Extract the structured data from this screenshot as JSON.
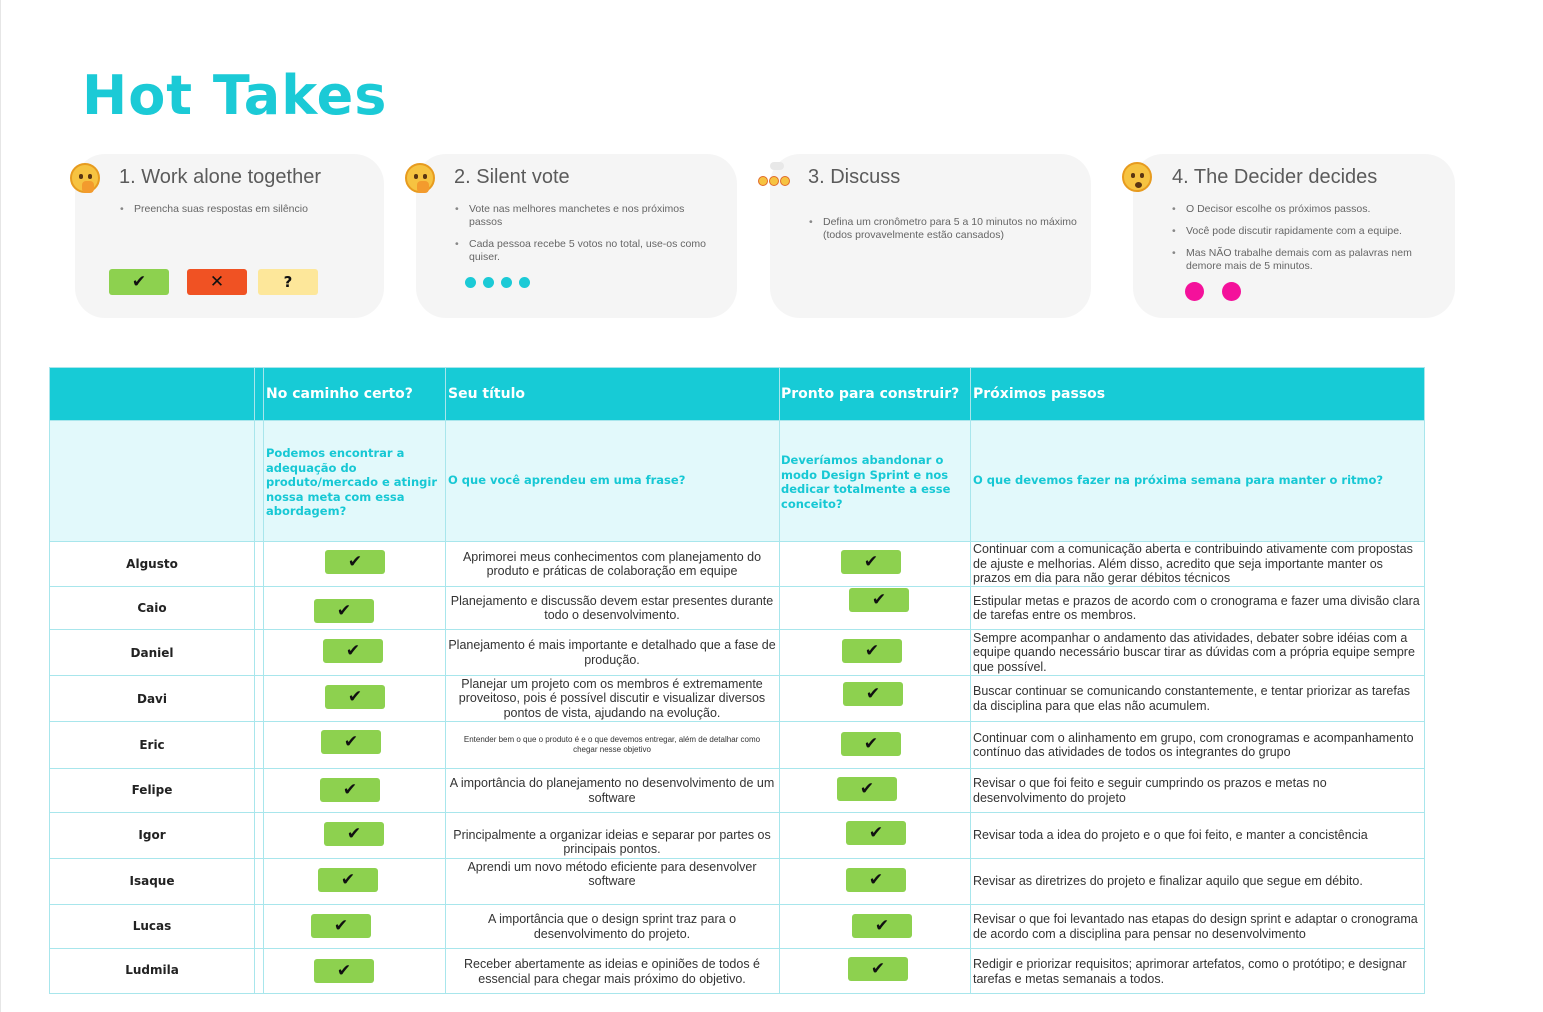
{
  "title": "Hot Takes",
  "steps": [
    {
      "heading": "1. Work alone together",
      "bullets": [
        "Preencha suas respostas em silêncio"
      ]
    },
    {
      "heading": "2. Silent vote",
      "bullets": [
        "Vote nas melhores manchetes e nos próximos passos",
        "Cada pessoa recebe 5 votos no total, use-os como quiser."
      ]
    },
    {
      "heading": "3. Discuss",
      "bullets": [
        "Defina um cronômetro para 5 a 10 minutos no máximo\n(todos provavelmente estão cansados)"
      ]
    },
    {
      "heading": "4. The Decider decides",
      "bullets": [
        "O Decisor escolhe os próximos passos.",
        "Você pode discutir rapidamente com a equipe.",
        "Mas NÃO trabalhe demais com as palavras nem demore mais de 5 minutos."
      ]
    }
  ],
  "vote_buttons": {
    "yes": "✔",
    "no": "✕",
    "maybe": "?"
  },
  "colors": {
    "accent": "#1bcad6",
    "green": "#8dd14f",
    "red": "#f05223",
    "yellow": "#fde79a",
    "magenta": "#f4119b"
  },
  "table": {
    "headers": [
      "No caminho certo?",
      "Seu título",
      "Pronto para construir?",
      "Próximos passos"
    ],
    "prompts": [
      "Podemos encontrar a adequação do produto/mercado e atingir nossa meta com essa abordagem?",
      "O que você aprendeu em uma frase?",
      "Deveríamos abandonar o modo Design Sprint e nos dedicar totalmente a esse conceito?",
      "O que devemos fazer na próxima semana para manter o ritmo?"
    ],
    "check_symbol": "✔",
    "rows": [
      {
        "name": "Algusto",
        "on_track": "✔",
        "title": "Aprimorei meus conhecimentos com planejamento do produto e práticas de colaboração em equipe",
        "ready": "✔",
        "next": "Continuar com a comunicação aberta e contribuindo ativamente com propostas de ajuste e melhorias. Além disso, acredito que seja importante manter os prazos em dia para não gerar débitos técnicos"
      },
      {
        "name": "Caio",
        "on_track": "✔",
        "title": "Planejamento e discussão devem estar presentes durante todo o desenvolvimento.",
        "ready": "✔",
        "next": "Estipular metas e prazos de acordo com o cronograma e fazer uma divisão clara de tarefas entre os membros."
      },
      {
        "name": "Daniel",
        "on_track": "✔",
        "title": "Planejamento é mais importante e detalhado que a fase de produção.",
        "ready": "✔",
        "next": "Sempre acompanhar o andamento das atividades, debater sobre idéias com a equipe quando necessário buscar tirar as dúvidas com a própria equipe sempre que possível."
      },
      {
        "name": "Davi",
        "on_track": "✔",
        "title": "Planejar um projeto com os membros é extremamente proveitoso, pois é possível discutir e visualizar diversos pontos de vista, ajudando na evolução.",
        "ready": "✔",
        "next": "Buscar continuar se comunicando constantemente, e tentar priorizar as tarefas da disciplina para que elas não acumulem."
      },
      {
        "name": "Eric",
        "on_track": "✔",
        "title": "Entender bem o que o produto é e o que devemos entregar, além de detalhar como chegar nesse objetivo",
        "ready": "✔",
        "next": "Continuar com o alinhamento em grupo, com cronogramas e acompanhamento contínuo das atividades de todos os integrantes do grupo"
      },
      {
        "name": "Felipe",
        "on_track": "✔",
        "title": "A importância do planejamento no desenvolvimento de um software",
        "ready": "✔",
        "next": "Revisar o que foi feito e seguir cumprindo os prazos e metas no desenvolvimento do projeto"
      },
      {
        "name": "Igor",
        "on_track": "✔",
        "title": "Principalmente a organizar ideias e separar por partes os principais pontos.",
        "ready": "✔",
        "next": "Revisar toda a idea do projeto e o que foi feito, e manter a concistência"
      },
      {
        "name": "Isaque",
        "on_track": "✔",
        "title": "Aprendi um novo método eficiente para desenvolver software",
        "ready": "✔",
        "next": "Revisar as diretrizes do projeto e finalizar aquilo que segue em débito."
      },
      {
        "name": "Lucas",
        "on_track": "✔",
        "title": "A importância que o design sprint traz para o desenvolvimento do projeto.",
        "ready": "✔",
        "next": "Revisar o que foi levantado nas etapas do design sprint e adaptar o cronograma de acordo com a disciplina para pensar no desenvolvimento"
      },
      {
        "name": "Ludmila",
        "on_track": "✔",
        "title": "Receber abertamente as ideias e opiniões de todos é essencial para chegar mais próximo do objetivo.",
        "ready": "✔",
        "next": "Redigir e priorizar requisitos; aprimorar artefatos, como o protótipo; e designar tarefas e metas semanais a todos."
      }
    ]
  }
}
